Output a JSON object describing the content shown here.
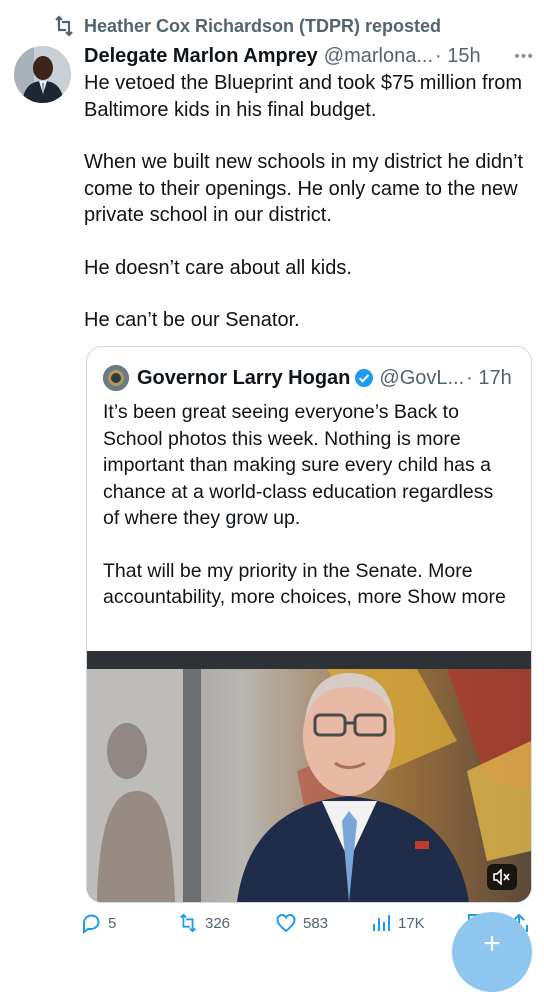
{
  "repost": {
    "icon": "repost-icon",
    "text": "Heather Cox Richardson (TDPR) reposted"
  },
  "tweet": {
    "author_name": "Delegate Marlon Amprey",
    "handle": "@marlona...",
    "time": "· 15h",
    "more_icon": "more-icon",
    "paragraphs": [
      "He vetoed the Blueprint and took $75 million from Baltimore kids in his final budget.",
      "When we built new schools in my district he didn’t come to their openings. He only came to the new private school in our district.",
      "He doesn’t care about all kids.",
      "He can’t be our Senator."
    ]
  },
  "quote": {
    "author_name": "Governor Larry Hogan",
    "handle": "@GovL...",
    "time": "· 17h",
    "paragraphs": [
      "It’s been great seeing everyone’s Back to School photos this week. Nothing is more important than making sure every child has a chance at a world-class education regardless of where they grow up.",
      "That will be my priority in the Senate. More accountability, more choices, more Show more"
    ],
    "mute_icon": "muted-speaker-icon"
  },
  "actions": {
    "replies": "5",
    "reposts": "326",
    "likes": "583",
    "views": "17K"
  },
  "colors": {
    "text": "#0f1419",
    "secondary": "#536471",
    "accent": "#1d9bf0"
  }
}
